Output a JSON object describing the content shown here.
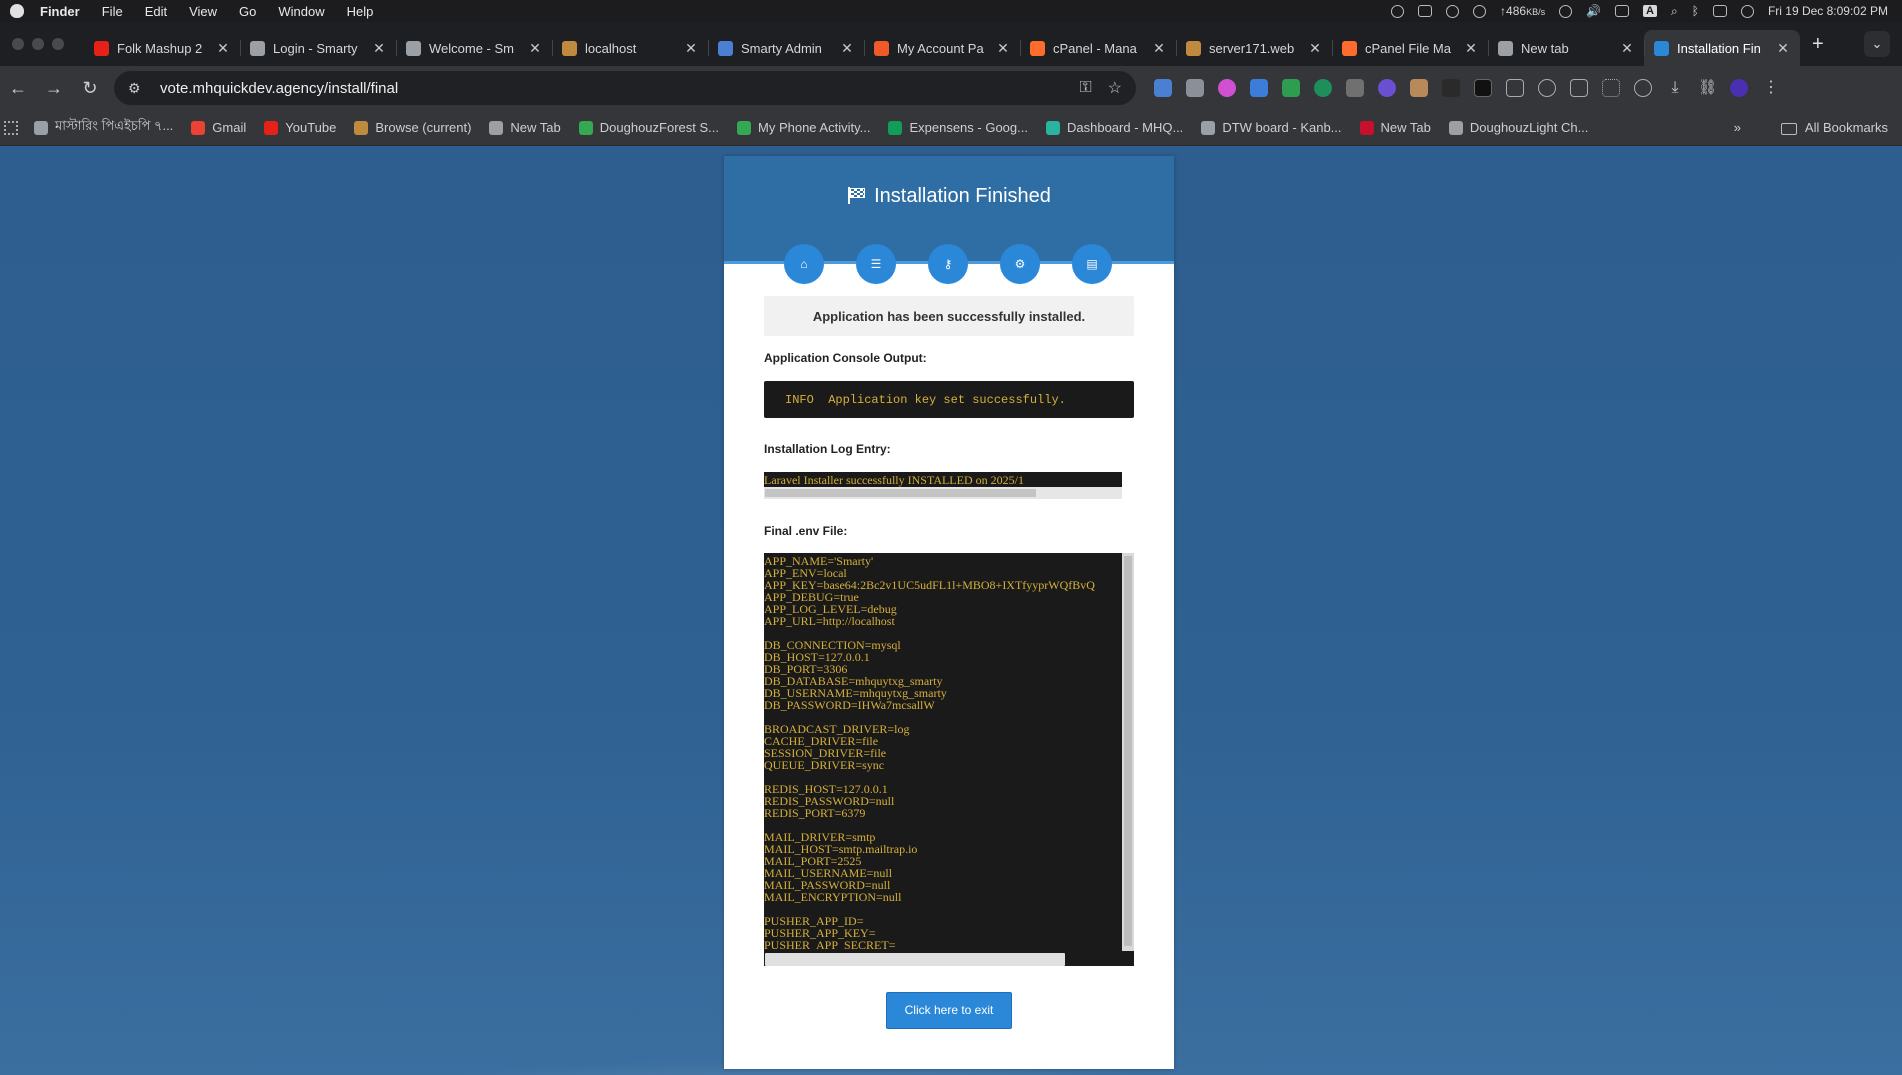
{
  "menubar": {
    "app": "Finder",
    "items": [
      "File",
      "Edit",
      "View",
      "Go",
      "Window",
      "Help"
    ],
    "net_speed": "↑486",
    "net_unit": "KB/s",
    "input_source": "A",
    "datetime": "Fri 19 Dec  8:09:02 PM"
  },
  "tabs": [
    {
      "label": "Folk Mashup 2",
      "icon": "youtube-icon",
      "color": "#e62117"
    },
    {
      "label": "Login - Smarty",
      "icon": "globe-icon",
      "color": "#9aa0a6"
    },
    {
      "label": "Welcome - Sm",
      "icon": "globe-icon",
      "color": "#9aa0a6"
    },
    {
      "label": "localhost",
      "icon": "laravel-forest-icon",
      "color": "#c08a3e"
    },
    {
      "label": "Smarty Admin",
      "icon": "smarty-icon",
      "color": "#4a7fd1"
    },
    {
      "label": "My Account Pa",
      "icon": "account-icon",
      "color": "#f05a28"
    },
    {
      "label": "cPanel - Mana",
      "icon": "cpanel-icon",
      "color": "#ff6c2c"
    },
    {
      "label": "server171.web",
      "icon": "server-icon",
      "color": "#c08a3e"
    },
    {
      "label": "cPanel File Ma",
      "icon": "cpanel-icon",
      "color": "#ff6c2c"
    },
    {
      "label": "New tab",
      "icon": "chrome-icon",
      "color": "#9aa0a6"
    },
    {
      "label": "Installation Fin",
      "icon": "installer-gear-icon",
      "color": "#2b87d8",
      "active": true
    }
  ],
  "toolbar": {
    "url": "vote.mhquickdev.agency/install/final"
  },
  "bookmarks": [
    {
      "label": "মাস্টারিং পিএইচপি ৭...",
      "color": "#9aa0a6"
    },
    {
      "label": "Gmail",
      "color": "#ea4335"
    },
    {
      "label": "YouTube",
      "color": "#e62117"
    },
    {
      "label": "Browse (current)",
      "color": "#c08a3e"
    },
    {
      "label": "New Tab",
      "color": "#9aa0a6"
    },
    {
      "label": "DoughouzForest S...",
      "color": "#34a853"
    },
    {
      "label": "My Phone Activity...",
      "color": "#34a853"
    },
    {
      "label": "Expensens - Goog...",
      "color": "#0f9d58"
    },
    {
      "label": "Dashboard - MHQ...",
      "color": "#2bb3a0"
    },
    {
      "label": "DTW board - Kanb...",
      "color": "#9aa0a6"
    },
    {
      "label": "New Tab",
      "color": "#c8102e"
    },
    {
      "label": "DoughouzLight Ch...",
      "color": "#9aa0a6"
    }
  ],
  "bookmarks_all": "All Bookmarks",
  "installer": {
    "title": "Installation Finished",
    "success_message": "Application has been successfully installed.",
    "console_label": "Application Console Output:",
    "console_output": "INFO  Application key set successfully.",
    "log_label": "Installation Log Entry:",
    "log_text": "Laravel Installer successfully INSTALLED on 2025/1",
    "env_label": "Final .env File:",
    "env_text": "APP_NAME='Smarty'\nAPP_ENV=local\nAPP_KEY=base64:2Bc2v1UC5udFL1l+MBO8+IXTfyyprWQfBvQ\nAPP_DEBUG=true\nAPP_LOG_LEVEL=debug\nAPP_URL=http://localhost\n\nDB_CONNECTION=mysql\nDB_HOST=127.0.0.1\nDB_PORT=3306\nDB_DATABASE=mhquytxg_smarty\nDB_USERNAME=mhquytxg_smarty\nDB_PASSWORD=IHWa7mcsallW\n\nBROADCAST_DRIVER=log\nCACHE_DRIVER=file\nSESSION_DRIVER=file\nQUEUE_DRIVER=sync\n\nREDIS_HOST=127.0.0.1\nREDIS_PASSWORD=null\nREDIS_PORT=6379\n\nMAIL_DRIVER=smtp\nMAIL_HOST=smtp.mailtrap.io\nMAIL_PORT=2525\nMAIL_USERNAME=null\nMAIL_PASSWORD=null\nMAIL_ENCRYPTION=null\n\nPUSHER_APP_ID=\nPUSHER_APP_KEY=\nPUSHER_APP_SECRET=",
    "exit_button": "Click here to exit",
    "steps": [
      "home-icon",
      "list-icon",
      "key-icon",
      "gear-icon",
      "server-icon"
    ]
  },
  "colors": {
    "accent": "#2b87d8",
    "header": "#2f6ea5",
    "console_text": "#d6b03a"
  }
}
